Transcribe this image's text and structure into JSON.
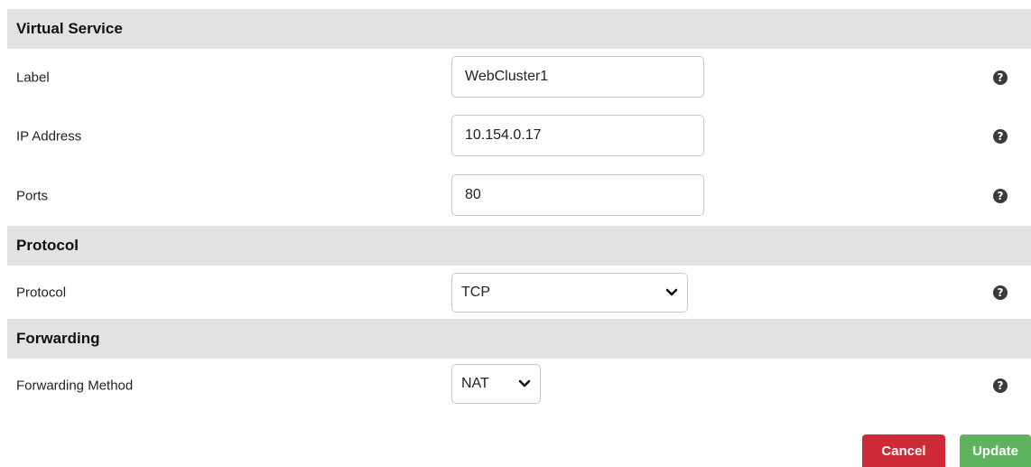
{
  "sections": {
    "virtual_service": "Virtual Service",
    "protocol": "Protocol",
    "forwarding": "Forwarding"
  },
  "fields": {
    "label": {
      "label": "Label",
      "value": "WebCluster1"
    },
    "ip_address": {
      "label": "IP Address",
      "value": "10.154.0.17"
    },
    "ports": {
      "label": "Ports",
      "value": "80"
    },
    "protocol": {
      "label": "Protocol",
      "value": "TCP"
    },
    "forwarding_method": {
      "label": "Forwarding Method",
      "value": "NAT"
    }
  },
  "help_glyph": "?",
  "buttons": {
    "cancel": "Cancel",
    "update": "Update"
  },
  "colors": {
    "header_bg": "#e2e2e2",
    "cancel": "#cf2a37",
    "update": "#5fb35f"
  },
  "icons": {
    "help": "question-circle-icon",
    "dropdown": "chevron-down-icon"
  }
}
